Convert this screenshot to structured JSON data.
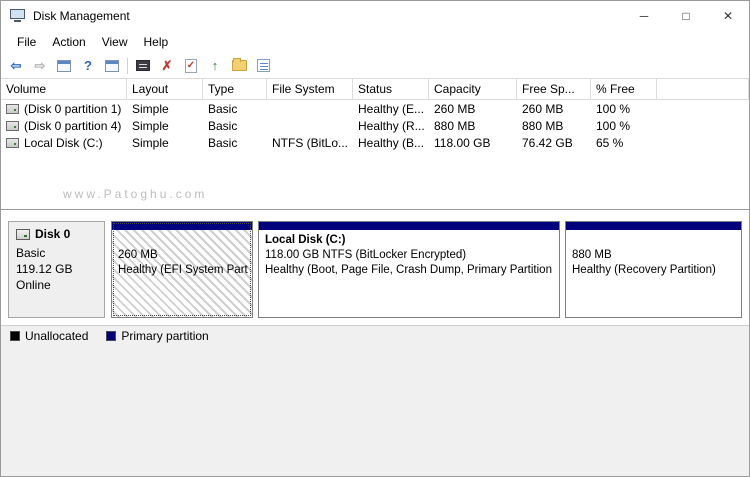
{
  "window": {
    "title": "Disk Management",
    "controls": {
      "minimize": "─",
      "maximize": "□",
      "close": "✕"
    }
  },
  "menu": {
    "items": [
      "File",
      "Action",
      "View",
      "Help"
    ]
  },
  "toolbar": {
    "glyphs": {
      "back": "⇦",
      "forward": "⇨",
      "help": "?",
      "delete": "✗",
      "check": "✓",
      "up": "↑"
    }
  },
  "table": {
    "columns": [
      "Volume",
      "Layout",
      "Type",
      "File System",
      "Status",
      "Capacity",
      "Free Sp...",
      "% Free"
    ],
    "rows": [
      {
        "volume": "(Disk 0 partition 1)",
        "layout": "Simple",
        "type": "Basic",
        "fs": "",
        "status": "Healthy (E...",
        "capacity": "260 MB",
        "free": "260 MB",
        "pct_free": "100 %"
      },
      {
        "volume": "(Disk 0 partition 4)",
        "layout": "Simple",
        "type": "Basic",
        "fs": "",
        "status": "Healthy (R...",
        "capacity": "880 MB",
        "free": "880 MB",
        "pct_free": "100 %"
      },
      {
        "volume": "Local Disk (C:)",
        "layout": "Simple",
        "type": "Basic",
        "fs": "NTFS (BitLo...",
        "status": "Healthy (B...",
        "capacity": "118.00 GB",
        "free": "76.42 GB",
        "pct_free": "65 %"
      }
    ]
  },
  "watermark": "www.Patoghu.com",
  "disk": {
    "name": "Disk 0",
    "type": "Basic",
    "size": "119.12 GB",
    "status": "Online",
    "partitions": [
      {
        "title": "",
        "line1": "260 MB",
        "line2": "Healthy (EFI System Part"
      },
      {
        "title": "Local Disk  (C:)",
        "line1": "118.00 GB NTFS (BitLocker Encrypted)",
        "line2": "Healthy (Boot, Page File, Crash Dump, Primary Partition"
      },
      {
        "title": "",
        "line1": "880 MB",
        "line2": "Healthy (Recovery Partition)"
      }
    ]
  },
  "legend": {
    "items": [
      {
        "label": "Unallocated",
        "color": "#000000"
      },
      {
        "label": "Primary partition",
        "color": "#00007e"
      }
    ]
  }
}
